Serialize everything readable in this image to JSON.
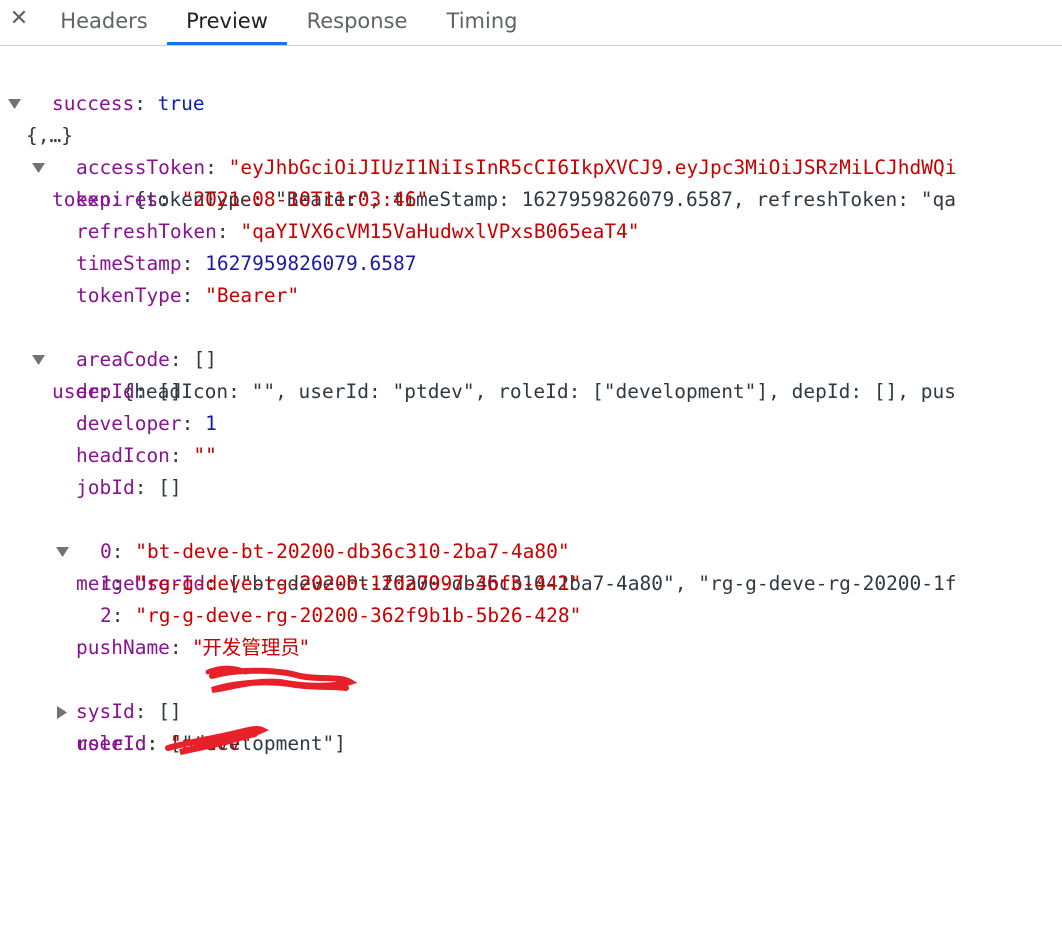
{
  "tabs": {
    "close": "✕",
    "headers": "Headers",
    "preview": "Preview",
    "response": "Response",
    "timing": "Timing"
  },
  "tree": {
    "root": "{,…}",
    "success_key": "success",
    "success_val": "true",
    "token_key": "token",
    "token_summary": "{tokenType: \"Bearer\", timeStamp: 1627959826079.6587, refreshToken: \"qa",
    "accessToken_key": "accessToken",
    "accessToken_val": "\"eyJhbGciOiJIUzI1NiIsInR5cCI6IkpXVCJ9.eyJpc3MiOiJSRzMiLCJhdWQi",
    "expires_key": "expires",
    "expires_val": "\"2021-08-10T11:03:46\"",
    "refreshToken_key": "refreshToken",
    "refreshToken_val": "\"qaYIVX6cVM15VaHudwxlVPxsB065eaT4\"",
    "timeStamp_key": "timeStamp",
    "timeStamp_val": "1627959826079.6587",
    "tokenType_key": "tokenType",
    "tokenType_val": "\"Bearer\"",
    "user_key": "user",
    "user_summary": "{headIcon: \"\", userId: \"ptdev\", roleId: [\"development\"], depId: [], pus",
    "areaCode_key": "areaCode",
    "areaCode_val": "[]",
    "depId_key": "depId",
    "depId_val": "[]",
    "developer_key": "developer",
    "developer_val": "1",
    "headIcon_key": "headIcon",
    "headIcon_val": "\"\"",
    "jobId_key": "jobId",
    "jobId_val": "[]",
    "mergeUserId_key": "mergeUserId",
    "mergeUserId_summary": "[\"bt-deve-bt-20200-db36c310-2ba7-4a80\", \"rg-g-deve-rg-20200-1f",
    "merge0_idx": "0",
    "merge0_val": "\"bt-deve-bt-20200-db36c310-2ba7-4a80\"",
    "merge1_idx": "1",
    "merge1_val": "\"rg-g-deve-rg-20200-1fda7997-4bfb-441\"",
    "merge2_idx": "2",
    "merge2_val": "\"rg-g-deve-rg-20200-362f9b1b-5b26-428\"",
    "pushName_key": "pushName",
    "pushName_val": "\"开发管理员\"",
    "roleId_key": "roleId",
    "roleId_val": "[\"development\"]",
    "sysId_key": "sysId",
    "sysId_val": "[]",
    "userId_key": "userId",
    "userId_val": "\"ptdev\""
  },
  "colors": {
    "key": "#881391",
    "string": "#c80000",
    "number": "#1a1aa6",
    "tab_active_underline": "#1a73e8",
    "redaction": "#e8202a"
  }
}
